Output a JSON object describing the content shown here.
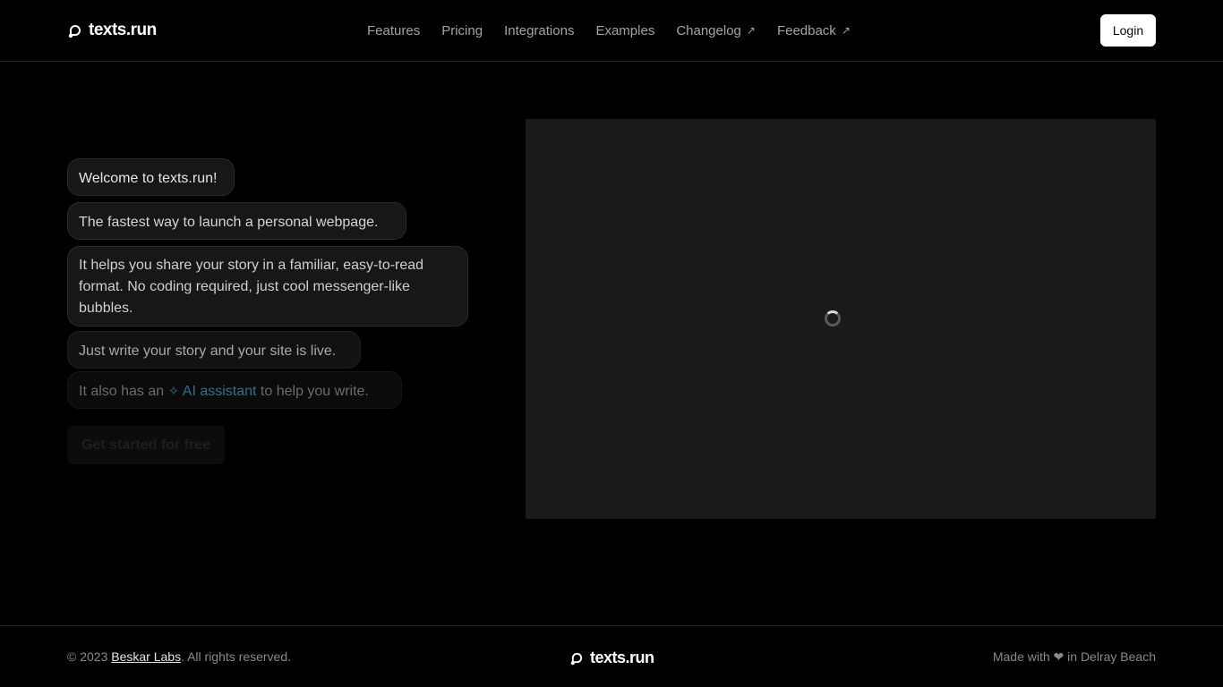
{
  "header": {
    "brand": "texts.run",
    "nav": [
      {
        "label": "Features",
        "external": false
      },
      {
        "label": "Pricing",
        "external": false
      },
      {
        "label": "Integrations",
        "external": false
      },
      {
        "label": "Examples",
        "external": false
      },
      {
        "label": "Changelog",
        "external": true
      },
      {
        "label": "Feedback",
        "external": true
      }
    ],
    "external_arrow": "↗",
    "login_label": "Login"
  },
  "hero": {
    "messages": [
      "Welcome to texts.run!",
      "The fastest way to launch a personal webpage.",
      "It helps you share your story in a familiar, easy-to-read format. No coding required, just cool messenger-like bubbles.",
      "Just write your story and your site is live."
    ],
    "ai_message": {
      "prefix": "It also has an",
      "link_label": "AI assistant",
      "suffix": "to help you write.",
      "icon": "sparkles-icon"
    },
    "cta_label": "Get started for free"
  },
  "preview": {
    "state": "loading",
    "icon": "spinner-icon"
  },
  "footer": {
    "copyright_prefix": "© 2023",
    "company": "Beskar Labs",
    "copyright_suffix": ". All rights reserved.",
    "brand": "texts.run",
    "made_with": "Made with ❤ in Delray Beach"
  },
  "colors": {
    "background": "#000000",
    "bubble": "#171717",
    "accent_link": "#2f6f89",
    "preview_bg": "#1a1a1a"
  }
}
